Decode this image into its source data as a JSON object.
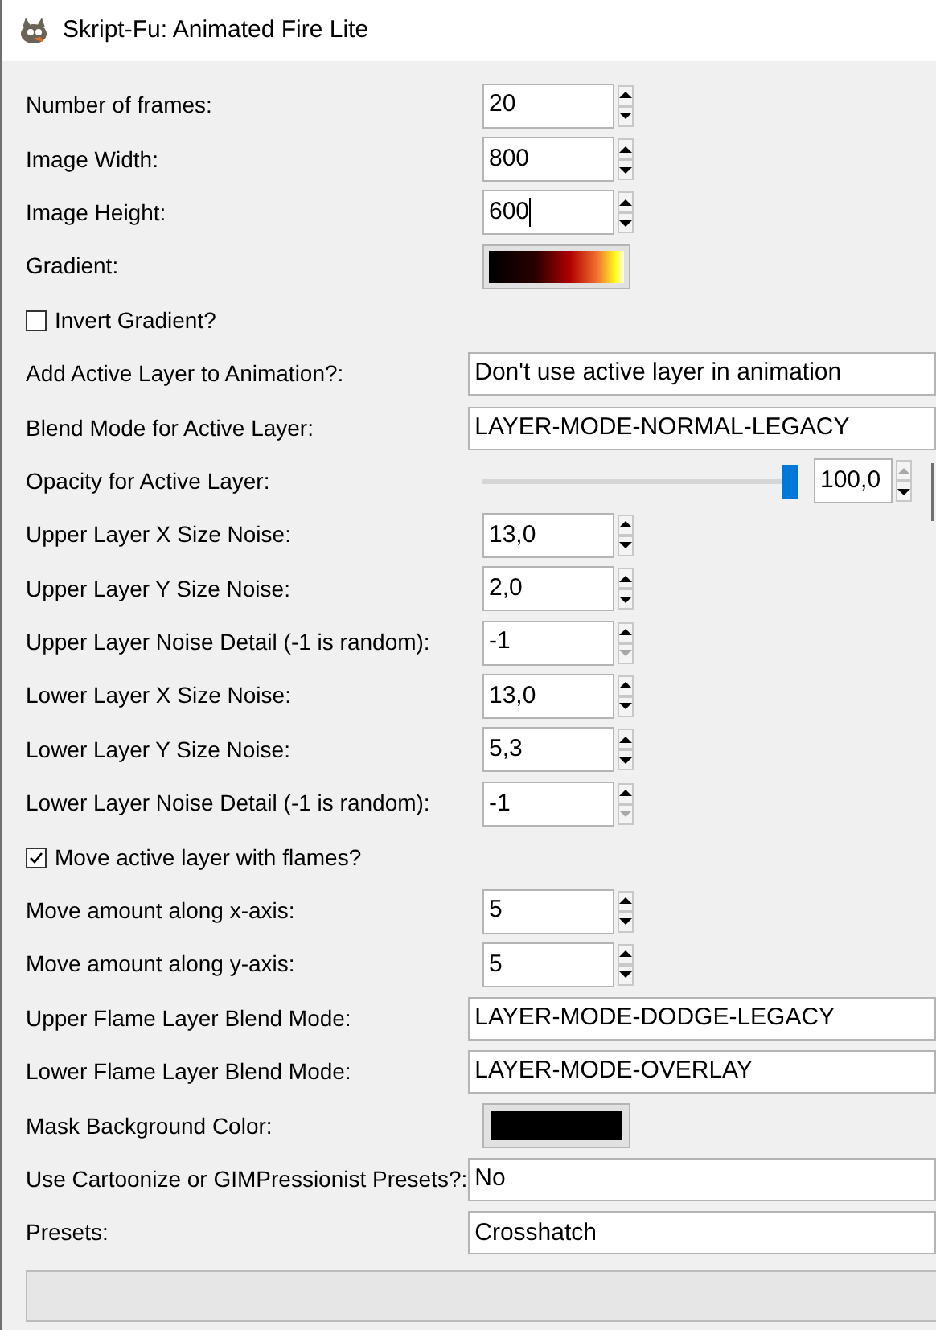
{
  "window": {
    "title": "Skript-Fu: Animated Fire Lite"
  },
  "fields": [
    {
      "kind": "spin",
      "label": "Number of frames:",
      "value": "20",
      "focused": false,
      "up_enabled": true,
      "down_enabled": true
    },
    {
      "kind": "spin",
      "label": "Image Width:",
      "value": "800",
      "focused": false,
      "up_enabled": true,
      "down_enabled": true
    },
    {
      "kind": "spin",
      "label": "Image Height:",
      "value": "600",
      "focused": true,
      "up_enabled": true,
      "down_enabled": true
    },
    {
      "kind": "gradient",
      "label": "Gradient:"
    },
    {
      "kind": "checkbox",
      "label": "Invert Gradient?",
      "checked": false
    },
    {
      "kind": "combo",
      "label": "Add Active Layer to Animation?:",
      "value": "Don't use active layer in animation"
    },
    {
      "kind": "combo",
      "label": "Blend Mode for Active Layer:",
      "value": "LAYER-MODE-NORMAL-LEGACY"
    },
    {
      "kind": "slider",
      "label": "Opacity for Active Layer:",
      "level": 1,
      "value": "100,0",
      "up_enabled": false,
      "down_enabled": true
    },
    {
      "kind": "spin",
      "label": "Upper Layer X Size Noise:",
      "value": "13,0",
      "focused": false,
      "up_enabled": true,
      "down_enabled": true
    },
    {
      "kind": "spin",
      "label": "Upper Layer Y Size Noise:",
      "value": "2,0",
      "focused": false,
      "up_enabled": true,
      "down_enabled": true
    },
    {
      "kind": "spin",
      "label": "Upper Layer Noise Detail (-1 is random):",
      "value": "-1",
      "focused": false,
      "up_enabled": true,
      "down_enabled": false
    },
    {
      "kind": "spin",
      "label": "Lower Layer X Size Noise:",
      "value": "13,0",
      "focused": false,
      "up_enabled": true,
      "down_enabled": true
    },
    {
      "kind": "spin",
      "label": "Lower Layer Y Size Noise:",
      "value": "5,3",
      "focused": false,
      "up_enabled": true,
      "down_enabled": true
    },
    {
      "kind": "spin",
      "label": "Lower Layer Noise Detail (-1 is random):",
      "value": "-1",
      "focused": false,
      "up_enabled": true,
      "down_enabled": false
    },
    {
      "kind": "checkbox",
      "label": "Move active layer with flames?",
      "checked": true
    },
    {
      "kind": "spin",
      "label": "Move amount along x-axis:",
      "value": "5",
      "focused": false,
      "up_enabled": true,
      "down_enabled": true
    },
    {
      "kind": "spin",
      "label": "Move amount along y-axis:",
      "value": "5",
      "focused": false,
      "up_enabled": true,
      "down_enabled": true
    },
    {
      "kind": "combo",
      "label": "Upper Flame Layer Blend Mode:",
      "value": "LAYER-MODE-DODGE-LEGACY"
    },
    {
      "kind": "combo",
      "label": "Lower Flame Layer Blend Mode:",
      "value": "LAYER-MODE-OVERLAY"
    },
    {
      "kind": "color",
      "label": "Mask Background Color:",
      "color": "#000000"
    },
    {
      "kind": "combo",
      "label": "Use Cartoonize or GIMPressionist Presets?:",
      "value": "No"
    },
    {
      "kind": "combo",
      "label": "Presets:",
      "value": "Crosshatch"
    }
  ]
}
